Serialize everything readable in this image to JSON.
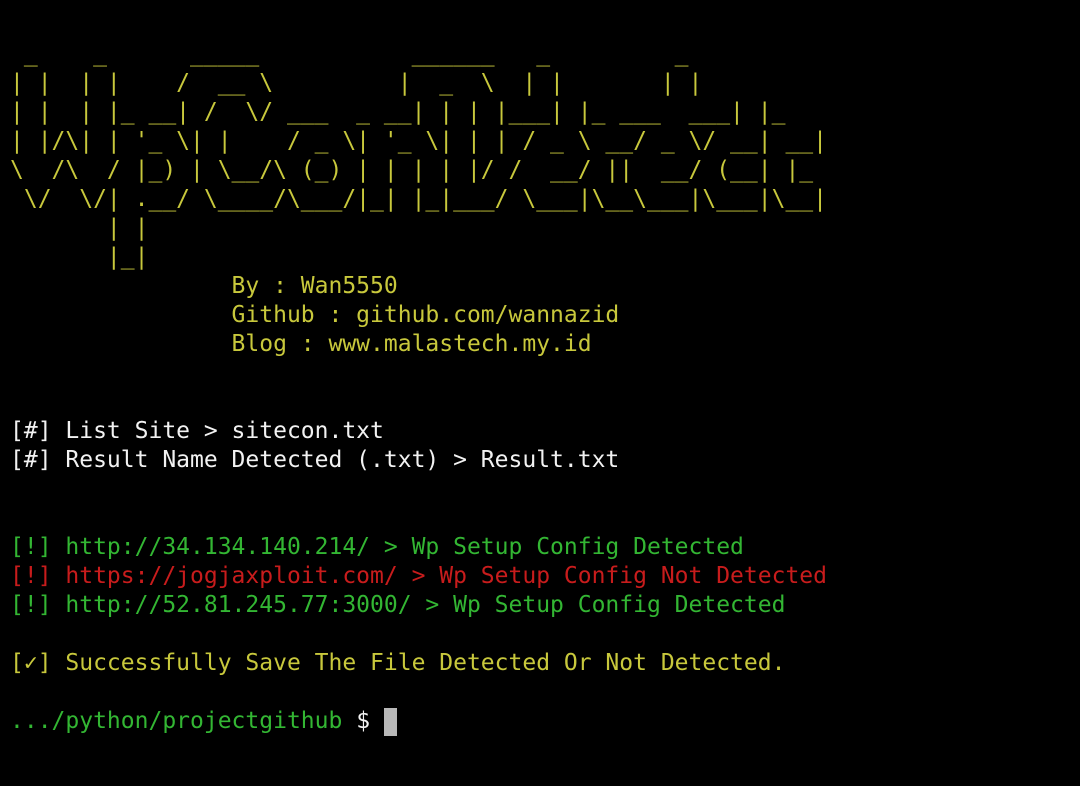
{
  "banner": {
    "ascii_lines": [
      " _    _      _____           ______   _         _",
      "| |  | |    /  __ \\         |  _  \\  | |       | |",
      "| |  | |_ __| /  \\/ ___  _ __| | | |___| |_ ___  ___| |_",
      "| |/\\| | '_ \\| |    / _ \\| '_ \\| | | / _ \\ __/ _ \\/ __| __|",
      "\\  /\\  / |_) | \\__/\\ (_) | | | | |/ /  __/ ||  __/ (__| |_",
      " \\/  \\/| .__/ \\____/\\___/|_| |_|___/ \\___|\\__\\___|\\___|\\__|",
      "       | |",
      "       |_|"
    ],
    "author": "                By : Wan5550",
    "github": "                Github : github.com/wannazid",
    "blog": "                Blog : www.malastech.my.id"
  },
  "info": {
    "list_site": "[#] List Site > sitecon.txt",
    "result_name": "[#] Result Name Detected (.txt) > Result.txt"
  },
  "results": [
    {
      "text": "[!] http://34.134.140.214/ > Wp Setup Config Detected",
      "status": "detected"
    },
    {
      "text": "[!] https://jogjaxploit.com/ > Wp Setup Config Not Detected",
      "status": "not-detected"
    },
    {
      "text": "[!] http://52.81.245.77:3000/ > Wp Setup Config Detected",
      "status": "detected"
    }
  ],
  "success_message": "[✓] Successfully Save The File Detected Or Not Detected.",
  "prompt": {
    "path": ".../python/projectgithub",
    "symbol": " $ "
  },
  "colors": {
    "banner": "#c8c83c",
    "info": "#f2f2f2",
    "detected": "#33b633",
    "not_detected": "#c81c1c",
    "background": "#000000"
  }
}
